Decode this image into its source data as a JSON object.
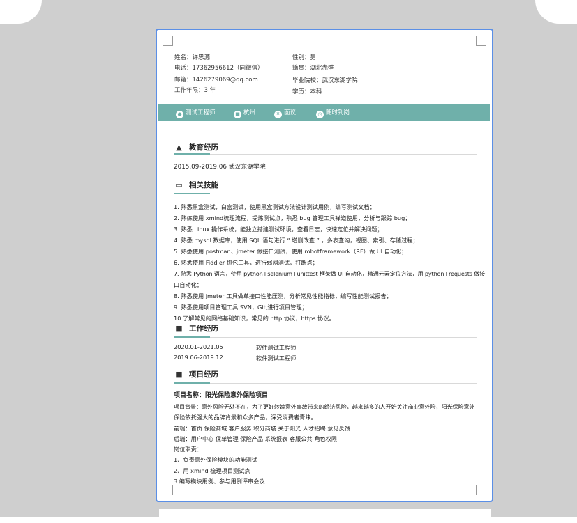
{
  "header": {
    "name": "姓名：许思源",
    "gender": "性别：男",
    "phone": "电话：17362956612（同微信）",
    "hometown": "籍贯：湖北赤壁",
    "email": "邮箱：1426279069@qq.com",
    "school": "毕业院校：武汉东湖学院",
    "experience": "工作年限：3 年",
    "degree": "学历：本科"
  },
  "banner": [
    {
      "label": "测试工程师",
      "icon": "person-icon"
    },
    {
      "label": "杭州",
      "icon": "building-icon"
    },
    {
      "label": "面议",
      "icon": "money-icon"
    },
    {
      "label": "随时到岗",
      "icon": "clock-icon"
    }
  ],
  "education": {
    "title": "教育经历",
    "entry": "2015.09-2019.06 武汉东湖学院"
  },
  "skills": {
    "title": "相关技能",
    "items": [
      "1. 熟悉黑盒测试，白盒测试，使用黑盒测试方法设计测试用例，编写测试文档；",
      "2. 熟练使用 xmind梳理流程，提炼测试点，熟悉 bug 管理工具禅道使用，分析与跟踪 bug；",
      "3. 熟悉 Linux 操作系统，能独立搭建测试环境，查看日志，快速定位并解决问题；",
      "4. 熟悉 mysql 数据库，使用 SQL 语句进行 “ 增删改查 ” ，多表查询，视图、索引、存储过程；",
      "5. 熟悉使用 postman、jmeter 做接口测试，使用 robotframework（RF）做 UI 自动化；",
      "6. 熟悉使用 Fiddler 抓包工具，进行弱网测试，打断点；",
      "7. 熟悉 Python 语言，使用 python+selenium+unittest 框架做 UI 自动化，精通元素定位方法，用 python+requests 做接",
      "口自动化；",
      "8. 熟悉使用 jmeter 工具做单接口性能压测，分析常见性能指标，编写性能测试报告；",
      "9. 熟悉使用项目管理工具 SVN，Git,进行项目管理；",
      "10.了解常见的网络基础知识，常见的 http 协议，https 协议。"
    ]
  },
  "work": {
    "title": "工作经历",
    "rows": [
      {
        "period": "2020.01-2021.05",
        "role": "软件测试工程师"
      },
      {
        "period": "2019.06-2019.12",
        "role": "软件测试工程师"
      }
    ]
  },
  "project": {
    "title": "项目经历",
    "name": "项目名称：阳光保险意外保险项目",
    "lines": [
      "项目背景：意外风险无处不在，为了更好转嫁意外事故带来的经济风险，越来越多的人开始关注商业意外险，阳光保险意外",
      "保险依托强大的品牌背景和众多产品，深受消费者青睐。",
      "前端：首页  保险商城  客户服务  积分商城  关于阳光  人才招聘  意见反馈",
      "后端：用户中心  保单管理  保险产品  系统报表    客服公共  角色权限",
      "岗位职责：",
      "1、负责意外保险模块的功能测试",
      "2、用 xmind 梳理项目测试点",
      "3.编写模块用例、参与用例评审会议"
    ]
  }
}
